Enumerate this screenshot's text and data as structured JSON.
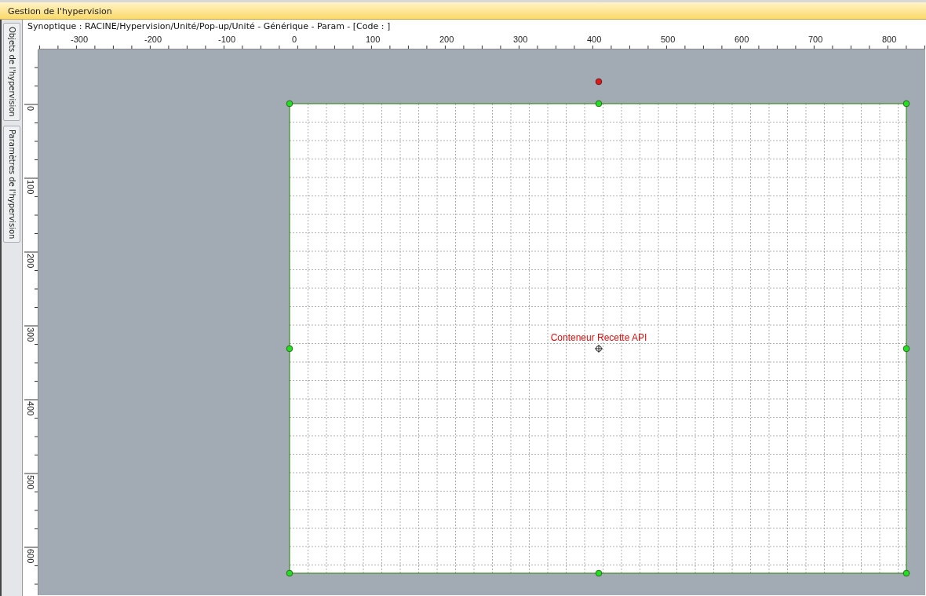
{
  "window": {
    "title": "Gestion de l'hypervision"
  },
  "side_tabs": [
    {
      "label": "Objets de l'hypervision",
      "selected": false
    },
    {
      "label": "Paramètres de l'hypervision",
      "selected": false
    }
  ],
  "path_bar": "Synoptique : RACINE/Hypervision/Unité/Pop-up/Unité - Générique - Param - [Code : ]",
  "horizontal_ruler": [
    "-300",
    "-200",
    "-100",
    "0",
    "100",
    "200",
    "300",
    "400",
    "500",
    "600",
    "700",
    "800"
  ],
  "vertical_ruler": [
    "0",
    "100",
    "200",
    "300",
    "400",
    "500",
    "600"
  ],
  "container": {
    "label": "Conteneur Recette API",
    "selected": true
  }
}
